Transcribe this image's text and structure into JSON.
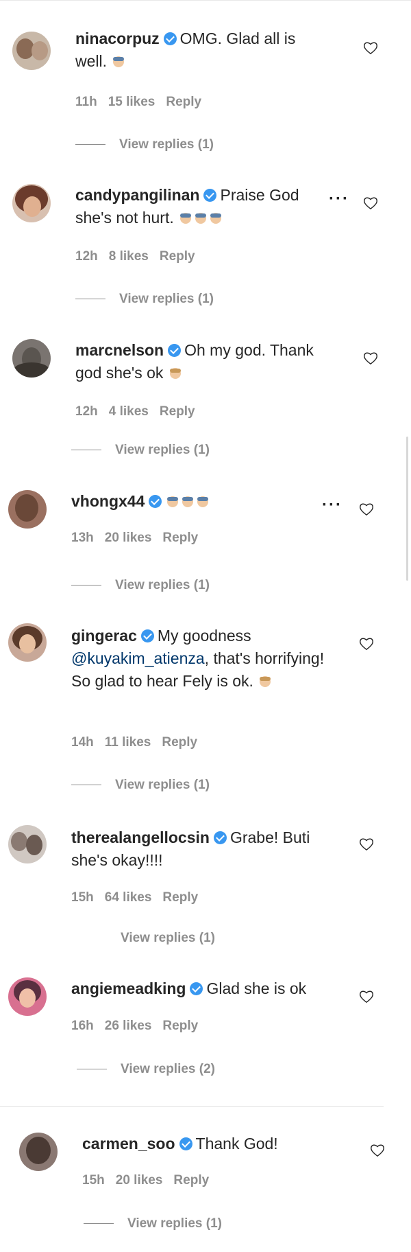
{
  "theme": {
    "verified_color": "#3897f0",
    "text_color": "#262626",
    "muted_color": "#8e8e8e",
    "mention_color": "#00376b"
  },
  "comments": [
    {
      "username": "ninacorpuz",
      "text": "OMG. Glad all is well.",
      "emoji_count": 1,
      "time": "11h",
      "likes": "15 likes",
      "reply_label": "Reply",
      "view_replies": "View replies (1)",
      "has_more_menu": false,
      "avatar_color": "#a08a78"
    },
    {
      "username": "candypangilinan",
      "text": "Praise God she's not hurt.",
      "emoji_count": 3,
      "time": "12h",
      "likes": "8 likes",
      "reply_label": "Reply",
      "view_replies": "View replies (1)",
      "has_more_menu": true,
      "avatar_color": "#6b3b2c"
    },
    {
      "username": "marcnelson",
      "text": "Oh my god. Thank god she's ok",
      "emoji_count": 1,
      "time": "12h",
      "likes": "4 likes",
      "reply_label": "Reply",
      "view_replies": "View replies (1)",
      "has_more_menu": false,
      "avatar_color": "#5a5550"
    },
    {
      "username": "vhongx44",
      "text": "",
      "emoji_count": 3,
      "time": "13h",
      "likes": "20 likes",
      "reply_label": "Reply",
      "view_replies": "View replies (1)",
      "has_more_menu": true,
      "avatar_color": "#7a5a48"
    },
    {
      "username": "gingerac",
      "text_before_mention": "My goodness",
      "mention": "@kuyakim_atienza",
      "text_after_mention": ", that's horrifying! So glad to hear Fely is ok.",
      "emoji_count": 1,
      "time": "14h",
      "likes": "11 likes",
      "reply_label": "Reply",
      "view_replies": "View replies (1)",
      "has_more_menu": false,
      "avatar_color": "#8b6a5a"
    },
    {
      "username": "therealangellocsin",
      "text": "Grabe! Buti she's okay!!!!",
      "emoji_count": 0,
      "time": "15h",
      "likes": "64 likes",
      "reply_label": "Reply",
      "view_replies": "View replies (1)",
      "has_more_menu": false,
      "avatar_color": "#9a8c84"
    },
    {
      "username": "angiemeadking",
      "text": "Glad she is ok",
      "emoji_count": 0,
      "time": "16h",
      "likes": "26 likes",
      "reply_label": "Reply",
      "view_replies": "View replies (2)",
      "has_more_menu": false,
      "avatar_color": "#b0566a"
    },
    {
      "username": "carmen_soo",
      "text": "Thank God!",
      "emoji_count": 0,
      "time": "15h",
      "likes": "20 likes",
      "reply_label": "Reply",
      "view_replies": "View replies (1)",
      "has_more_menu": false,
      "avatar_color": "#6e5e58"
    }
  ]
}
